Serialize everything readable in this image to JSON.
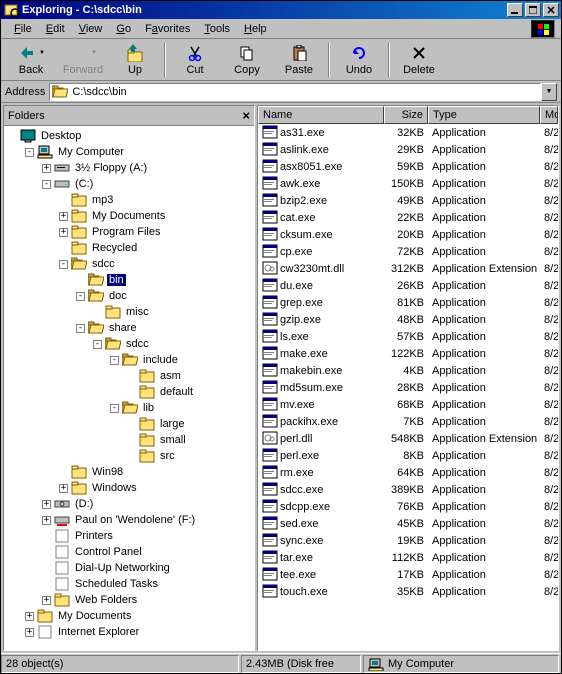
{
  "title": "Exploring - C:\\sdcc\\bin",
  "menu": [
    "File",
    "Edit",
    "View",
    "Go",
    "Favorites",
    "Tools",
    "Help"
  ],
  "toolbar": {
    "back": "Back",
    "forward": "Forward",
    "up": "Up",
    "cut": "Cut",
    "copy": "Copy",
    "paste": "Paste",
    "undo": "Undo",
    "delete": "Delete"
  },
  "address": {
    "label": "Address",
    "value": "C:\\sdcc\\bin"
  },
  "folders_label": "Folders",
  "tree": [
    {
      "d": 0,
      "e": "",
      "i": "desktop",
      "l": "Desktop"
    },
    {
      "d": 1,
      "e": "-",
      "i": "mycomp",
      "l": "My Computer"
    },
    {
      "d": 2,
      "e": "+",
      "i": "floppy",
      "l": "3½ Floppy (A:)"
    },
    {
      "d": 2,
      "e": "-",
      "i": "drive",
      "l": "(C:)"
    },
    {
      "d": 3,
      "e": "",
      "i": "fc",
      "l": "mp3"
    },
    {
      "d": 3,
      "e": "+",
      "i": "fc",
      "l": "My Documents"
    },
    {
      "d": 3,
      "e": "+",
      "i": "fc",
      "l": "Program Files"
    },
    {
      "d": 3,
      "e": "",
      "i": "fc",
      "l": "Recycled"
    },
    {
      "d": 3,
      "e": "-",
      "i": "fo",
      "l": "sdcc"
    },
    {
      "d": 4,
      "e": "",
      "i": "fo",
      "l": "bin",
      "sel": true
    },
    {
      "d": 4,
      "e": "-",
      "i": "fo",
      "l": "doc"
    },
    {
      "d": 5,
      "e": "",
      "i": "fc",
      "l": "misc"
    },
    {
      "d": 4,
      "e": "-",
      "i": "fo",
      "l": "share"
    },
    {
      "d": 5,
      "e": "-",
      "i": "fo",
      "l": "sdcc"
    },
    {
      "d": 6,
      "e": "-",
      "i": "fo",
      "l": "include"
    },
    {
      "d": 7,
      "e": "",
      "i": "fc",
      "l": "asm"
    },
    {
      "d": 7,
      "e": "",
      "i": "fc",
      "l": "default"
    },
    {
      "d": 6,
      "e": "-",
      "i": "fo",
      "l": "lib"
    },
    {
      "d": 7,
      "e": "",
      "i": "fc",
      "l": "large"
    },
    {
      "d": 7,
      "e": "",
      "i": "fc",
      "l": "small"
    },
    {
      "d": 7,
      "e": "",
      "i": "fc",
      "l": "src"
    },
    {
      "d": 3,
      "e": "",
      "i": "fc",
      "l": "Win98"
    },
    {
      "d": 3,
      "e": "+",
      "i": "fc",
      "l": "Windows"
    },
    {
      "d": 2,
      "e": "+",
      "i": "cdrom",
      "l": "(D:)"
    },
    {
      "d": 2,
      "e": "+",
      "i": "netdrive",
      "l": "Paul on 'Wendolene' (F:)"
    },
    {
      "d": 2,
      "e": "",
      "i": "printer",
      "l": "Printers"
    },
    {
      "d": 2,
      "e": "",
      "i": "ctrl",
      "l": "Control Panel"
    },
    {
      "d": 2,
      "e": "",
      "i": "dun",
      "l": "Dial-Up Networking"
    },
    {
      "d": 2,
      "e": "",
      "i": "sched",
      "l": "Scheduled Tasks"
    },
    {
      "d": 2,
      "e": "+",
      "i": "web",
      "l": "Web Folders"
    },
    {
      "d": 1,
      "e": "+",
      "i": "mydocs",
      "l": "My Documents"
    },
    {
      "d": 1,
      "e": "+",
      "i": "ie",
      "l": "Internet Explorer"
    }
  ],
  "columns": [
    "Name",
    "Size",
    "Type",
    "Mo"
  ],
  "files": [
    {
      "i": "exe",
      "n": "as31.exe",
      "s": "32KB",
      "t": "Application",
      "m": "8/2"
    },
    {
      "i": "exe",
      "n": "aslink.exe",
      "s": "29KB",
      "t": "Application",
      "m": "8/2"
    },
    {
      "i": "exe",
      "n": "asx8051.exe",
      "s": "59KB",
      "t": "Application",
      "m": "8/2"
    },
    {
      "i": "exe",
      "n": "awk.exe",
      "s": "150KB",
      "t": "Application",
      "m": "8/2"
    },
    {
      "i": "exe",
      "n": "bzip2.exe",
      "s": "49KB",
      "t": "Application",
      "m": "8/2"
    },
    {
      "i": "exe",
      "n": "cat.exe",
      "s": "22KB",
      "t": "Application",
      "m": "8/2"
    },
    {
      "i": "exe",
      "n": "cksum.exe",
      "s": "20KB",
      "t": "Application",
      "m": "8/2"
    },
    {
      "i": "exe",
      "n": "cp.exe",
      "s": "72KB",
      "t": "Application",
      "m": "8/2"
    },
    {
      "i": "dll",
      "n": "cw3230mt.dll",
      "s": "312KB",
      "t": "Application Extension",
      "m": "8/2"
    },
    {
      "i": "exe",
      "n": "du.exe",
      "s": "26KB",
      "t": "Application",
      "m": "8/2"
    },
    {
      "i": "exe",
      "n": "grep.exe",
      "s": "81KB",
      "t": "Application",
      "m": "8/2"
    },
    {
      "i": "exe",
      "n": "gzip.exe",
      "s": "48KB",
      "t": "Application",
      "m": "8/2"
    },
    {
      "i": "exe",
      "n": "ls.exe",
      "s": "57KB",
      "t": "Application",
      "m": "8/2"
    },
    {
      "i": "exe",
      "n": "make.exe",
      "s": "122KB",
      "t": "Application",
      "m": "8/2"
    },
    {
      "i": "exe",
      "n": "makebin.exe",
      "s": "4KB",
      "t": "Application",
      "m": "8/2"
    },
    {
      "i": "exe",
      "n": "md5sum.exe",
      "s": "28KB",
      "t": "Application",
      "m": "8/2"
    },
    {
      "i": "exe",
      "n": "mv.exe",
      "s": "68KB",
      "t": "Application",
      "m": "8/2"
    },
    {
      "i": "exe",
      "n": "packihx.exe",
      "s": "7KB",
      "t": "Application",
      "m": "8/2"
    },
    {
      "i": "dll",
      "n": "perl.dll",
      "s": "548KB",
      "t": "Application Extension",
      "m": "8/2"
    },
    {
      "i": "exe",
      "n": "perl.exe",
      "s": "8KB",
      "t": "Application",
      "m": "8/2"
    },
    {
      "i": "exe",
      "n": "rm.exe",
      "s": "64KB",
      "t": "Application",
      "m": "8/2"
    },
    {
      "i": "exe",
      "n": "sdcc.exe",
      "s": "389KB",
      "t": "Application",
      "m": "8/2"
    },
    {
      "i": "exe",
      "n": "sdcpp.exe",
      "s": "76KB",
      "t": "Application",
      "m": "8/2"
    },
    {
      "i": "exe",
      "n": "sed.exe",
      "s": "45KB",
      "t": "Application",
      "m": "8/2"
    },
    {
      "i": "exe",
      "n": "sync.exe",
      "s": "19KB",
      "t": "Application",
      "m": "8/2"
    },
    {
      "i": "exe",
      "n": "tar.exe",
      "s": "112KB",
      "t": "Application",
      "m": "8/2"
    },
    {
      "i": "exe",
      "n": "tee.exe",
      "s": "17KB",
      "t": "Application",
      "m": "8/2"
    },
    {
      "i": "exe",
      "n": "touch.exe",
      "s": "35KB",
      "t": "Application",
      "m": "8/2"
    }
  ],
  "status": {
    "objects": "28 object(s)",
    "disk": "2.43MB (Disk free",
    "loc": "My Computer"
  }
}
